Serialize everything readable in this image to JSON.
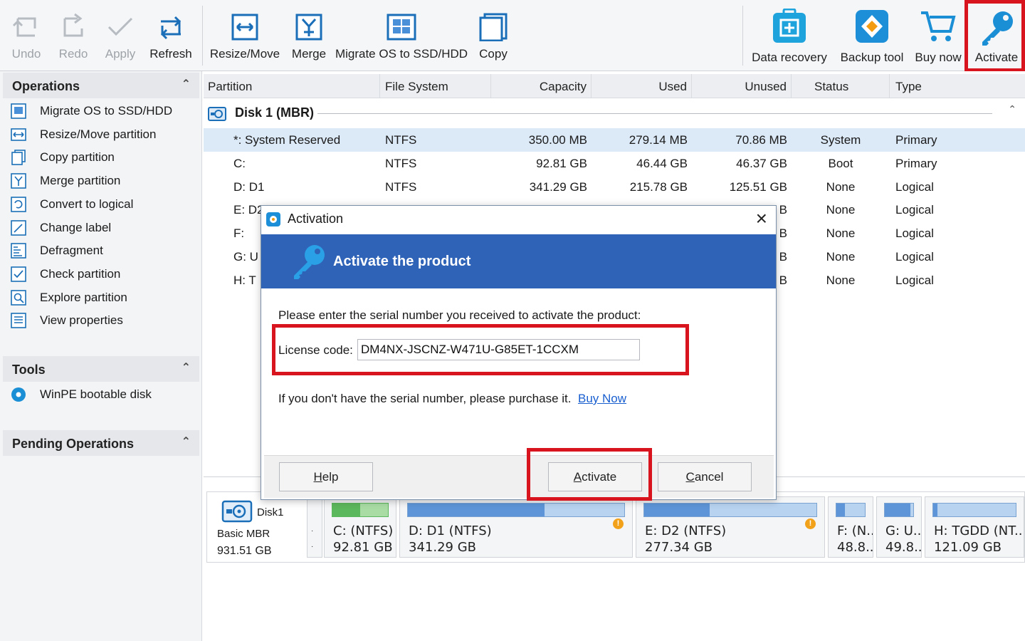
{
  "toolbar": {
    "undo": "Undo",
    "redo": "Redo",
    "apply": "Apply",
    "refresh": "Refresh",
    "resize_move": "Resize/Move",
    "merge": "Merge",
    "migrate_os": "Migrate OS to SSD/HDD",
    "copy": "Copy",
    "data_recovery": "Data recovery",
    "backup_tool": "Backup tool",
    "buy_now": "Buy now",
    "activate": "Activate"
  },
  "left_panel": {
    "operations_title": "Operations",
    "operations": [
      {
        "label": "Migrate OS to SSD/HDD",
        "icon": "migrate-icon"
      },
      {
        "label": "Resize/Move partition",
        "icon": "resize-icon"
      },
      {
        "label": "Copy partition",
        "icon": "copy-icon"
      },
      {
        "label": "Merge partition",
        "icon": "merge-icon"
      },
      {
        "label": "Convert to logical",
        "icon": "convert-icon"
      },
      {
        "label": "Change label",
        "icon": "label-icon"
      },
      {
        "label": "Defragment",
        "icon": "defragment-icon"
      },
      {
        "label": "Check partition",
        "icon": "check-icon"
      },
      {
        "label": "Explore partition",
        "icon": "explore-icon"
      },
      {
        "label": "View properties",
        "icon": "properties-icon"
      }
    ],
    "tools_title": "Tools",
    "tools": [
      {
        "label": "WinPE bootable disk",
        "icon": "disc-icon"
      }
    ],
    "pending_title": "Pending Operations"
  },
  "table": {
    "headers": [
      "Partition",
      "File System",
      "Capacity",
      "Used",
      "Unused",
      "Status",
      "Type"
    ],
    "disk_label": "Disk 1 (MBR)",
    "rows": [
      {
        "partition": "*: System Reserved",
        "fs": "NTFS",
        "capacity": "350.00 MB",
        "used": "279.14 MB",
        "unused": "70.86 MB",
        "status": "System",
        "type": "Primary"
      },
      {
        "partition": "C:",
        "fs": "NTFS",
        "capacity": "92.81 GB",
        "used": "46.44 GB",
        "unused": "46.37 GB",
        "status": "Boot",
        "type": "Primary"
      },
      {
        "partition": "D: D1",
        "fs": "NTFS",
        "capacity": "341.29 GB",
        "used": "215.78 GB",
        "unused": "125.51 GB",
        "status": "None",
        "type": "Logical"
      },
      {
        "partition": "E: D2",
        "fs": "",
        "capacity": "",
        "used": "",
        "unused": "B",
        "status": "None",
        "type": "Logical"
      },
      {
        "partition": "F:",
        "fs": "",
        "capacity": "",
        "used": "",
        "unused": "B",
        "status": "None",
        "type": "Logical"
      },
      {
        "partition": "G: U",
        "fs": "",
        "capacity": "",
        "used": "",
        "unused": "B",
        "status": "None",
        "type": "Logical"
      },
      {
        "partition": "H: T",
        "fs": "",
        "capacity": "",
        "used": "",
        "unused": "B",
        "status": "None",
        "type": "Logical"
      }
    ]
  },
  "diskmap": {
    "disk_name": "Disk1",
    "disk_type": "Basic MBR",
    "disk_size": "931.51 GB",
    "partitions": [
      {
        "line1": "C: (NTFS)",
        "line2": "92.81 GB",
        "fill": 0.5,
        "color": "#5cb85c"
      },
      {
        "line1": "D: D1 (NTFS)",
        "line2": "341.29 GB",
        "fill": 0.63,
        "color": "#5d95d8"
      },
      {
        "line1": "E: D2 (NTFS)",
        "line2": "277.34 GB",
        "fill": 0.38,
        "color": "#5d95d8"
      },
      {
        "line1": "F: (N..",
        "line2": "48.8..",
        "fill": 0.3,
        "color": "#5d95d8"
      },
      {
        "line1": "G: U..",
        "line2": "49.8..",
        "fill": 0.9,
        "color": "#5d95d8"
      },
      {
        "line1": "H: TGDD (NT..",
        "line2": "121.09 GB",
        "fill": 0.05,
        "color": "#5d95d8"
      }
    ]
  },
  "dialog": {
    "title": "Activation",
    "banner": "Activate the product",
    "instruction": "Please enter the serial number you received to activate the product:",
    "license_label": "License code:",
    "license_value": "DM4NX-JSCNZ-W471U-G85ET-1CCXM",
    "purchase_text": "If you don't have the serial number, please purchase it.",
    "buy_now_link": "Buy Now",
    "help": "Help",
    "activate": "Activate",
    "cancel": "Cancel"
  },
  "colors": {
    "highlight": "#d8141e",
    "banner": "#2f63b7",
    "accent": "#1b8fd6"
  }
}
